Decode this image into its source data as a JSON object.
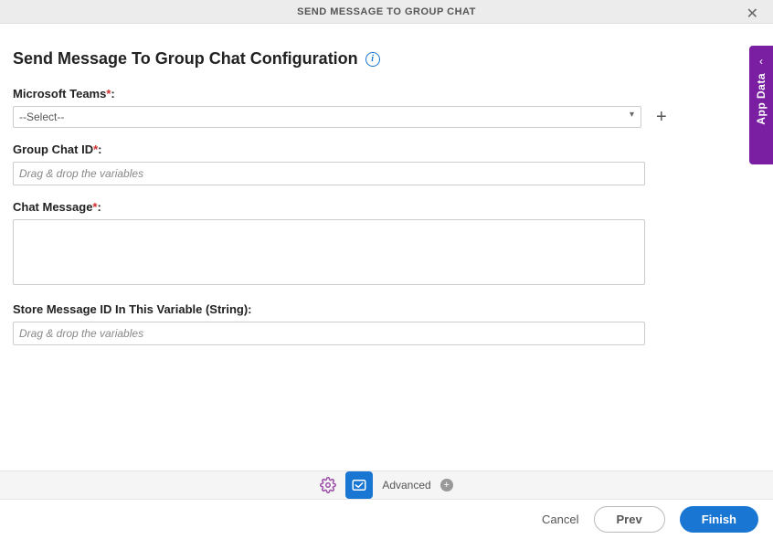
{
  "header": {
    "title": "SEND MESSAGE TO GROUP CHAT"
  },
  "page": {
    "title": "Send Message To Group Chat Configuration"
  },
  "fields": {
    "msTeams": {
      "label": "Microsoft Teams",
      "required": "*",
      "selected": "--Select--"
    },
    "groupChatId": {
      "label": "Group Chat ID",
      "required": "*",
      "placeholder": "Drag & drop the variables",
      "value": ""
    },
    "chatMessage": {
      "label": "Chat Message",
      "required": "*",
      "value": ""
    },
    "storeMessageId": {
      "label": "Store Message ID In This Variable (String):",
      "placeholder": "Drag & drop the variables",
      "value": ""
    }
  },
  "toolbar": {
    "advanced": "Advanced"
  },
  "footer": {
    "cancel": "Cancel",
    "prev": "Prev",
    "finish": "Finish"
  },
  "sidetab": {
    "label": "App Data"
  },
  "colors": {
    "primary": "#1976d2",
    "accent": "#7b1fa2"
  }
}
